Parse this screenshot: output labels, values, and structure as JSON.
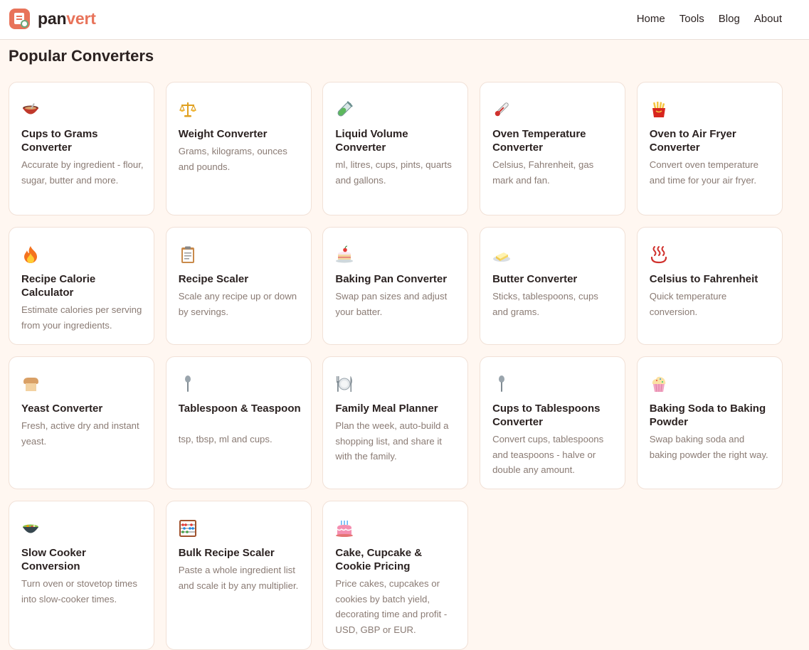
{
  "brand": {
    "pan": "pan",
    "vert": "vert"
  },
  "nav": [
    {
      "label": "Home"
    },
    {
      "label": "Tools"
    },
    {
      "label": "Blog"
    },
    {
      "label": "About"
    }
  ],
  "main": {
    "title": "Popular Converters"
  },
  "cards": [
    {
      "icon": "mixing-bowl-icon",
      "title": "Cups to Grams Converter",
      "desc": "Accurate by ingredient - flour, sugar, butter and more."
    },
    {
      "icon": "balance-scale-icon",
      "title": "Weight Converter",
      "desc": "Grams, kilograms, ounces and pounds."
    },
    {
      "icon": "test-tube-icon",
      "title": "Liquid Volume Converter",
      "desc": "ml, litres, cups, pints, quarts and gallons."
    },
    {
      "icon": "thermometer-icon",
      "title": "Oven Temperature Converter",
      "desc": "Celsius, Fahrenheit, gas mark and fan."
    },
    {
      "icon": "french-fries-icon",
      "title": "Oven to Air Fryer Converter",
      "desc": "Convert oven temperature and time for your air fryer."
    },
    {
      "icon": "fire-icon",
      "title": "Recipe Calorie Calculator",
      "desc": "Estimate calories per serving from your ingredients."
    },
    {
      "icon": "clipboard-icon",
      "title": "Recipe Scaler",
      "desc": "Scale any recipe up or down by servings."
    },
    {
      "icon": "cake-slice-icon",
      "title": "Baking Pan Converter",
      "desc": "Swap pan sizes and adjust your batter."
    },
    {
      "icon": "butter-icon",
      "title": "Butter Converter",
      "desc": "Sticks, tablespoons, cups and grams."
    },
    {
      "icon": "hot-springs-icon",
      "title": "Celsius to Fahrenheit",
      "desc": "Quick temperature conversion."
    },
    {
      "icon": "bread-icon",
      "title": "Yeast Converter",
      "desc": "Fresh, active dry and instant yeast."
    },
    {
      "icon": "spoon-icon",
      "title": "Tablespoon & Teaspoon",
      "desc": "tsp, tbsp, ml and cups."
    },
    {
      "icon": "plate-cutlery-icon",
      "title": "Family Meal Planner",
      "desc": "Plan the week, auto-build a shopping list, and share it with the family."
    },
    {
      "icon": "spoon-icon",
      "title": "Cups to Tablespoons Converter",
      "desc": "Convert cups, tablespoons and teaspoons - halve or double any amount."
    },
    {
      "icon": "cupcake-icon",
      "title": "Baking Soda to Baking Powder",
      "desc": "Swap baking soda and baking powder the right way."
    },
    {
      "icon": "stew-pot-icon",
      "title": "Slow Cooker Conversion",
      "desc": "Turn oven or stovetop times into slow-cooker times."
    },
    {
      "icon": "abacus-icon",
      "title": "Bulk Recipe Scaler",
      "desc": "Paste a whole ingredient list and scale it by any multiplier."
    },
    {
      "icon": "birthday-cake-icon",
      "title": "Cake, Cupcake & Cookie Pricing",
      "desc": "Price cakes, cupcakes or cookies by batch yield, decorating time and profit - USD, GBP or EUR."
    }
  ]
}
